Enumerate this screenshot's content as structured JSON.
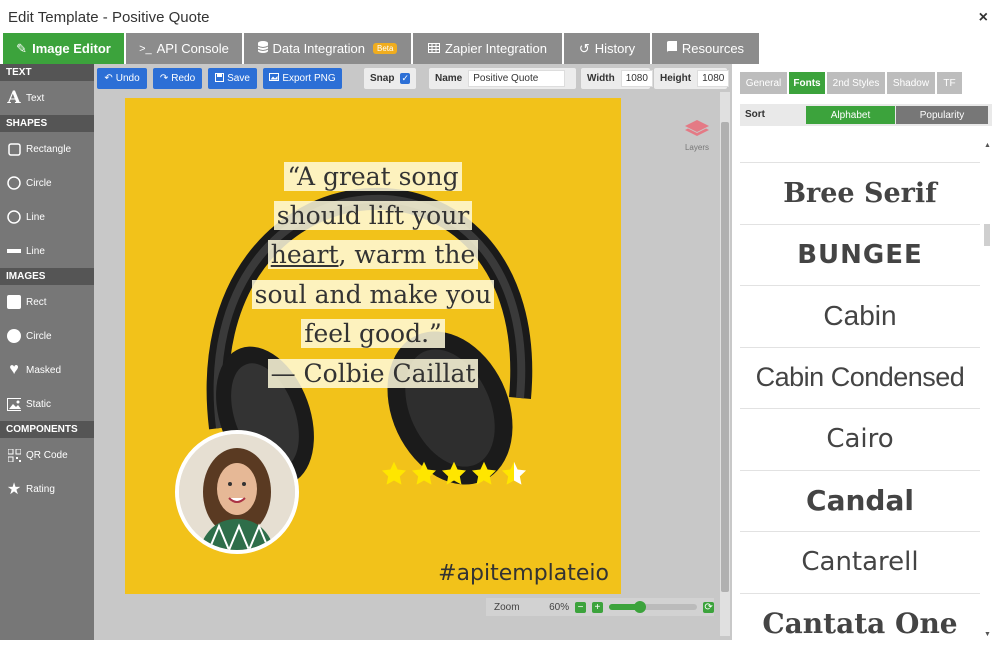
{
  "window": {
    "title": "Edit Template - Positive Quote",
    "close": "×"
  },
  "tabs": [
    {
      "label": "Image Editor",
      "icon": "pencil-icon"
    },
    {
      "label": "API Console",
      "icon": "terminal-icon"
    },
    {
      "label": "Data Integration",
      "icon": "database-icon",
      "badge": "Beta"
    },
    {
      "label": "Zapier Integration",
      "icon": "table-icon"
    },
    {
      "label": "History",
      "icon": "history-icon"
    },
    {
      "label": "Resources",
      "icon": "book-icon"
    }
  ],
  "sidebar": {
    "text_header": "TEXT",
    "text_item": "Text",
    "shapes_header": "SHAPES",
    "shapes": [
      "Rectangle",
      "Circle",
      "Line",
      "Line"
    ],
    "images_header": "IMAGES",
    "images": [
      "Rect",
      "Circle",
      "Masked",
      "Static"
    ],
    "components_header": "COMPONENTS",
    "components": [
      "QR Code",
      "Rating"
    ]
  },
  "toolbar": {
    "undo": "Undo",
    "redo": "Redo",
    "save": "Save",
    "export": "Export PNG",
    "snap_label": "Snap",
    "snap_checked": true,
    "name_label": "Name",
    "name_value": "Positive Quote",
    "width_label": "Width",
    "width_value": "1080",
    "height_label": "Height",
    "height_value": "1080"
  },
  "canvas": {
    "quote_lines": [
      "“A great song",
      "should lift your",
      "heart, warm the",
      "soul and make you",
      "feel good.”",
      "— Colbie Caillat"
    ],
    "underlined_word": "heart",
    "hashtag": "#apitemplateio",
    "rating": 4.5,
    "background_color": "#f2c21a"
  },
  "layers_label": "Layers",
  "zoom": {
    "label": "Zoom",
    "value": "60%",
    "level": 0.35
  },
  "rpanel": {
    "tabs": [
      "General",
      "Fonts",
      "2nd Styles",
      "Shadow",
      "TF"
    ],
    "active_tab": "Fonts",
    "sort_label": "Sort",
    "sort_options": [
      "Alphabet",
      "Popularity"
    ],
    "fonts": [
      "Bree Serif",
      "BUNGEE",
      "Cabin",
      "Cabin Condensed",
      "Cairo",
      "Candal",
      "Cantarell",
      "Cantata One"
    ]
  },
  "colors": {
    "accent": "#3ca33c",
    "button": "#2c6fd6",
    "sidebar": "#777777",
    "tab": "#8c8c8c"
  }
}
